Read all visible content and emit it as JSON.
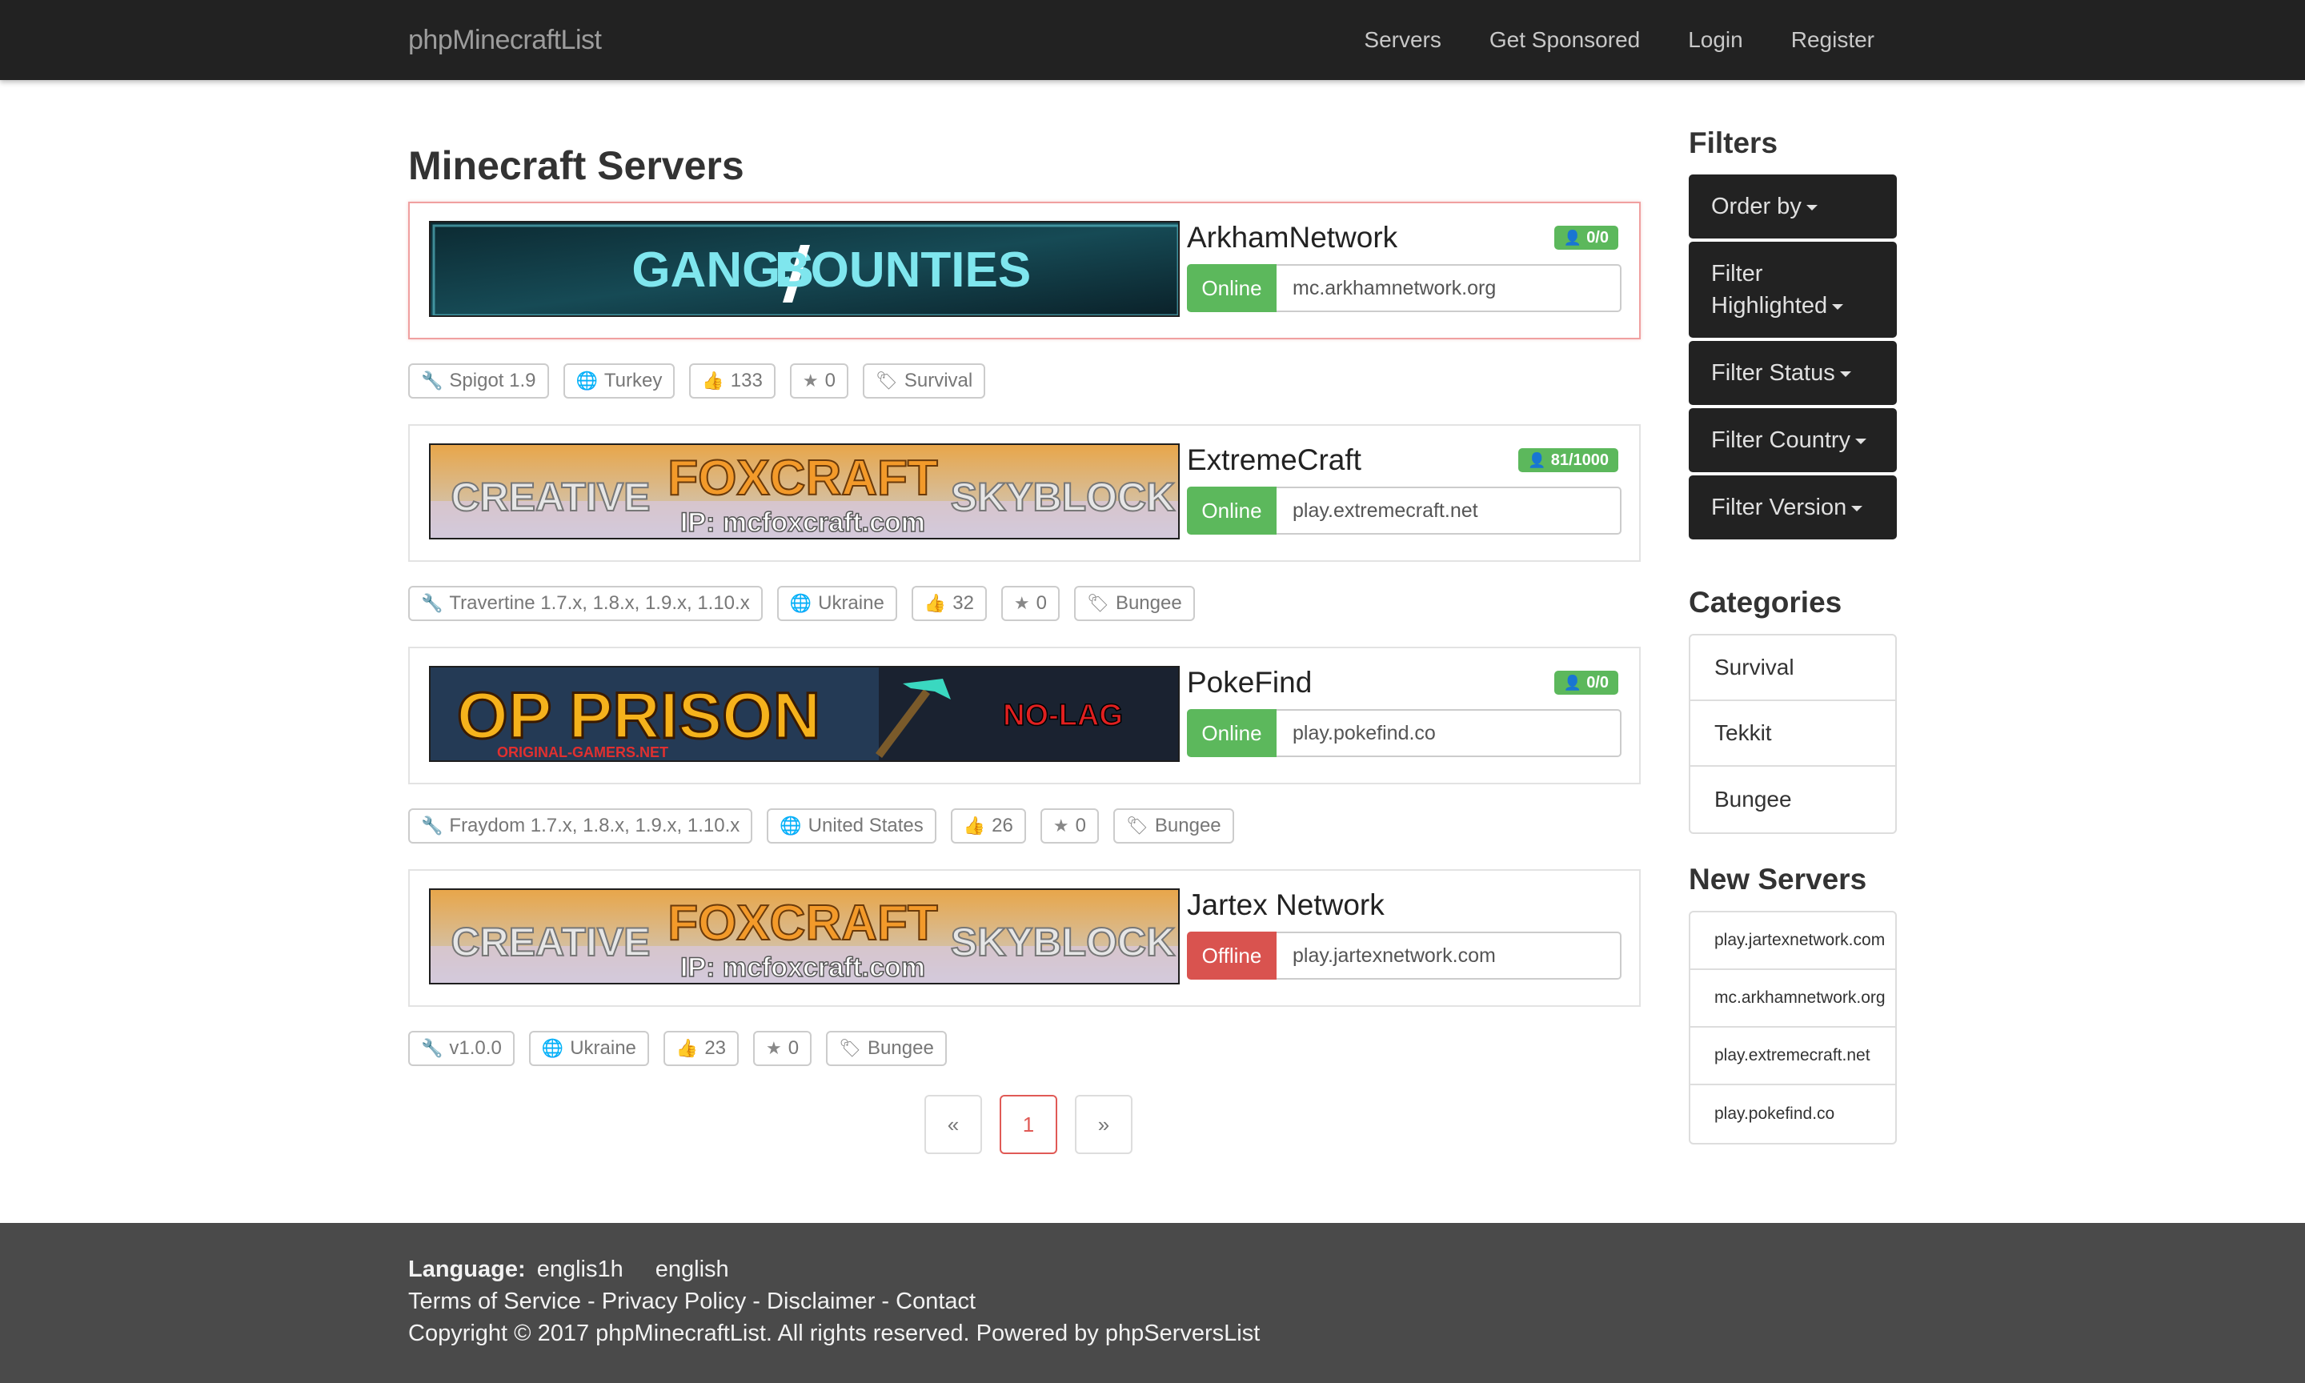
{
  "navbar": {
    "brand": "phpMinecraftList",
    "links": [
      "Servers",
      "Get Sponsored",
      "Login",
      "Register"
    ]
  },
  "main": {
    "title": "Minecraft Servers",
    "servers": [
      {
        "name": "ArkhamNetwork",
        "players": "0/0",
        "status": "Online",
        "ip": "mc.arkhamnetwork.org",
        "banner_text": [
          "GANGS",
          "BOUNTIES"
        ],
        "tags": {
          "version": "Spigot 1.9",
          "country": "Turkey",
          "votes": "133",
          "rating": "0",
          "category": "Survival"
        }
      },
      {
        "name": "ExtremeCraft",
        "players": "81/1000",
        "status": "Online",
        "ip": "play.extremecraft.net",
        "banner_text": [
          "CREATIVE",
          "FOXCRAFT",
          "SKYBLOCK",
          "IP: mcfoxcraft.com"
        ],
        "tags": {
          "version": "Travertine 1.7.x, 1.8.x, 1.9.x, 1.10.x",
          "country": "Ukraine",
          "votes": "32",
          "rating": "0",
          "category": "Bungee"
        }
      },
      {
        "name": "PokeFind",
        "players": "0/0",
        "status": "Online",
        "ip": "play.pokefind.co",
        "banner_text": [
          "OP PRISON",
          "NO-LAG",
          "ORIGINAL-GAMERS.NET"
        ],
        "tags": {
          "version": "Fraydom 1.7.x, 1.8.x, 1.9.x, 1.10.x",
          "country": "United States",
          "votes": "26",
          "rating": "0",
          "category": "Bungee"
        }
      },
      {
        "name": "Jartex Network",
        "players": "",
        "status": "Offline",
        "ip": "play.jartexnetwork.com",
        "banner_text": [
          "CREATIVE",
          "FOXCRAFT",
          "SKYBLOCK",
          "IP: mcfoxcraft.com"
        ],
        "tags": {
          "version": "v1.0.0",
          "country": "Ukraine",
          "votes": "23",
          "rating": "0",
          "category": "Bungee"
        }
      }
    ],
    "pagination": {
      "prev": "«",
      "current": "1",
      "next": "»"
    }
  },
  "sidebar": {
    "filters_heading": "Filters",
    "filters": [
      "Order by",
      "Filter Highlighted",
      "Filter Status",
      "Filter Country",
      "Filter Version"
    ],
    "categories_heading": "Categories",
    "categories": [
      "Survival",
      "Tekkit",
      "Bungee"
    ],
    "new_servers_heading": "New Servers",
    "new_servers": [
      "play.jartexnetwork.com",
      "mc.arkhamnetwork.org",
      "play.extremecraft.net",
      "play.pokefind.co"
    ]
  },
  "footer": {
    "language_label": "Language:",
    "language_options": [
      "englis1h",
      "english"
    ],
    "links": [
      "Terms of Service",
      "Privacy Policy",
      "Disclaimer",
      "Contact"
    ],
    "separator": " - ",
    "copyright": "Copyright © 2017 phpMinecraftList. All rights reserved. Powered by phpServersList"
  },
  "colors": {
    "navbar_bg": "#222222",
    "online": "#5cb85c",
    "offline": "#d9534f",
    "footer_bg": "#4a4a4a",
    "highlight_border": "#f0a0a0"
  },
  "icons": {
    "version": "wrench-icon",
    "country": "globe-icon",
    "votes": "thumbs-up-icon",
    "rating": "star-icon",
    "category": "tags-icon",
    "players": "user-icon"
  }
}
